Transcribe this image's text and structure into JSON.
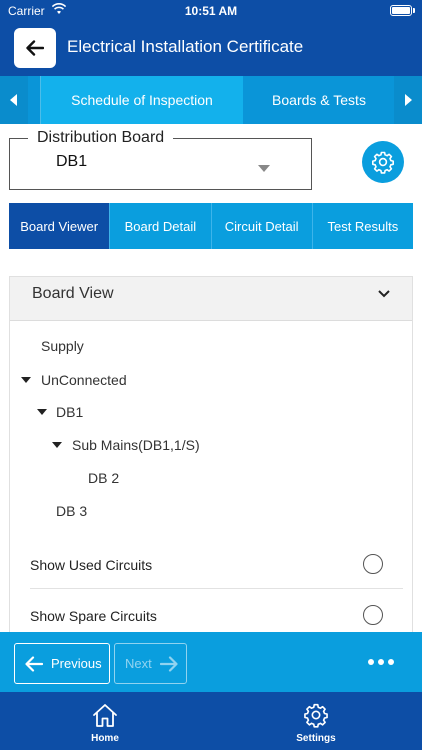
{
  "status_bar": {
    "carrier": "Carrier",
    "time": "10:51 AM"
  },
  "header": {
    "title": "Electrical Installation Certificate"
  },
  "tabs": [
    {
      "label": "Schedule of Inspection",
      "active": true
    },
    {
      "label": "Boards & Tests",
      "active": false
    }
  ],
  "distribution_board": {
    "legend": "Distribution Board",
    "value": "DB1"
  },
  "segment_tabs": [
    {
      "label": "Board Viewer",
      "active": true
    },
    {
      "label": "Board Detail",
      "active": false
    },
    {
      "label": "Circuit Detail",
      "active": false
    },
    {
      "label": "Test Results",
      "active": false
    }
  ],
  "board_view": {
    "title": "Board View",
    "tree": [
      "Supply",
      "UnConnected",
      "DB1",
      "Sub Mains(DB1,1/S)",
      "DB 2",
      "DB 3"
    ]
  },
  "options": [
    {
      "label": "Show Used Circuits",
      "checked": false
    },
    {
      "label": "Show Spare Circuits",
      "checked": false
    }
  ],
  "footer": {
    "previous_label": "Previous",
    "next_label": "Next"
  },
  "bottom_nav": [
    {
      "label": "Home",
      "icon": "home-icon"
    },
    {
      "label": "Settings",
      "icon": "gear-icon"
    }
  ],
  "colors": {
    "primary": "#0d4ea6",
    "accent": "#0a9ede",
    "active_tab": "#13b1ec"
  }
}
